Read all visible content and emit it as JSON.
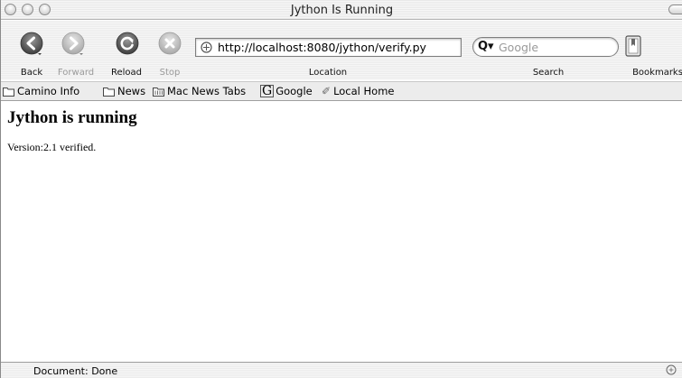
{
  "window": {
    "title": "Jython Is Running"
  },
  "toolbar": {
    "back_label": "Back",
    "forward_label": "Forward",
    "reload_label": "Reload",
    "stop_label": "Stop",
    "location_label": "Location",
    "search_label": "Search",
    "bookmarks_label": "Bookmarks",
    "url": "http://localhost:8080/jython/verify.py",
    "search_placeholder": "Google"
  },
  "bookmarks_bar": {
    "items": [
      {
        "label": "Camino Info",
        "icon": "folder-icon"
      },
      {
        "label": "News",
        "icon": "folder-icon"
      },
      {
        "label": "Mac News Tabs",
        "icon": "tabs-folder-icon"
      },
      {
        "label": "Google",
        "icon": "google-g-icon"
      },
      {
        "label": "Local Home",
        "icon": "pen-icon"
      }
    ]
  },
  "page": {
    "heading": "Jython is running",
    "body": "Version:2.1 verified."
  },
  "status": {
    "text": "Document: Done"
  }
}
